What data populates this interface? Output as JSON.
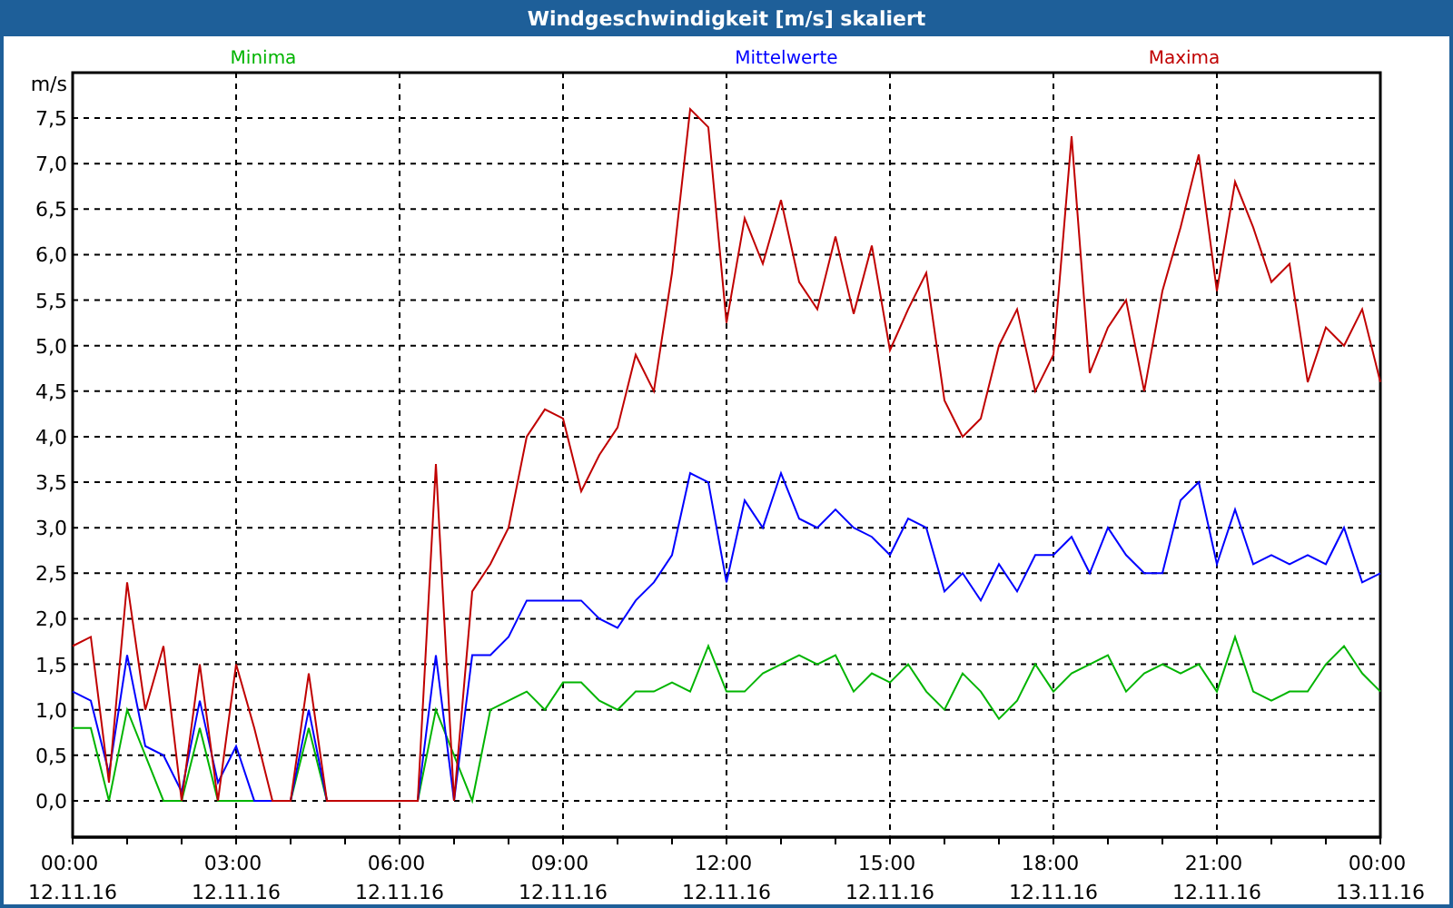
{
  "chart_data": {
    "type": "line",
    "title": "Windgeschwindigkeit [m/s] skaliert",
    "ylabel": "m/s",
    "categories": [
      "00:00 12.11.16",
      null,
      null,
      null,
      null,
      null,
      null,
      null,
      null,
      "03:00 12.11.16",
      null,
      null,
      null,
      null,
      null,
      null,
      null,
      null,
      "06:00 12.11.16",
      null,
      null,
      null,
      null,
      null,
      null,
      null,
      null,
      "09:00 12.11.16",
      null,
      null,
      null,
      null,
      null,
      null,
      null,
      null,
      "12:00 12.11.16",
      null,
      null,
      null,
      null,
      null,
      null,
      null,
      null,
      "15:00 12.11.16",
      null,
      null,
      null,
      null,
      null,
      null,
      null,
      null,
      "18:00 12.11.16",
      null,
      null,
      null,
      null,
      null,
      null,
      null,
      null,
      "21:00 12.11.16",
      null,
      null,
      null,
      null,
      null,
      null,
      null,
      null,
      "00:00 13.11.16"
    ],
    "series": [
      {
        "name": "Minima",
        "color": "#00b400",
        "values": [
          0.8,
          0.8,
          0,
          1.0,
          0.5,
          0,
          0,
          0.8,
          0,
          0,
          0,
          0,
          0,
          0.8,
          0,
          0,
          0,
          0,
          0,
          0,
          1.0,
          0.5,
          0,
          1.0,
          1.1,
          1.2,
          1.0,
          1.3,
          1.3,
          1.1,
          1.0,
          1.2,
          1.2,
          1.3,
          1.2,
          1.7,
          1.2,
          1.2,
          1.4,
          1.5,
          1.6,
          1.5,
          1.6,
          1.2,
          1.4,
          1.3,
          1.5,
          1.2,
          1.0,
          1.4,
          1.2,
          0.9,
          1.1,
          1.5,
          1.2,
          1.4,
          1.5,
          1.6,
          1.2,
          1.4,
          1.5,
          1.4,
          1.5,
          1.2,
          1.8,
          1.2,
          1.1,
          1.2,
          1.2,
          1.5,
          1.7,
          1.4,
          1.2
        ]
      },
      {
        "name": "Mittelwerte",
        "color": "#0000ff",
        "values": [
          1.2,
          1.1,
          0.3,
          1.6,
          0.6,
          0.5,
          0.1,
          1.1,
          0.2,
          0.6,
          0,
          0,
          0,
          1.0,
          0,
          0,
          0,
          0,
          0,
          0,
          1.6,
          0,
          1.6,
          1.6,
          1.8,
          2.2,
          2.2,
          2.2,
          2.2,
          2.0,
          1.9,
          2.2,
          2.4,
          2.7,
          3.6,
          3.5,
          2.4,
          3.3,
          3.0,
          3.6,
          3.1,
          3.0,
          3.2,
          3.0,
          2.9,
          2.7,
          3.1,
          3.0,
          2.3,
          2.5,
          2.2,
          2.6,
          2.3,
          2.7,
          2.7,
          2.9,
          2.5,
          3.0,
          2.7,
          2.5,
          2.5,
          3.3,
          3.5,
          2.6,
          3.2,
          2.6,
          2.7,
          2.6,
          2.7,
          2.6,
          3.0,
          2.4,
          2.5
        ]
      },
      {
        "name": "Maxima",
        "color": "#c00000",
        "values": [
          1.7,
          1.8,
          0.2,
          2.4,
          1.0,
          1.7,
          0,
          1.5,
          0,
          1.5,
          0.8,
          0,
          0,
          1.4,
          0,
          0,
          0,
          0,
          0,
          0,
          3.7,
          0,
          2.3,
          2.6,
          3.0,
          4.0,
          4.3,
          4.2,
          3.4,
          3.8,
          4.1,
          4.9,
          4.5,
          5.8,
          7.6,
          7.4,
          5.25,
          6.4,
          5.9,
          6.6,
          5.7,
          5.4,
          6.2,
          5.35,
          6.1,
          4.95,
          5.4,
          5.8,
          4.4,
          4.0,
          4.2,
          5.0,
          5.4,
          4.5,
          4.9,
          7.3,
          4.7,
          5.2,
          5.5,
          4.5,
          5.6,
          6.3,
          7.1,
          5.6,
          6.8,
          6.3,
          5.7,
          5.9,
          4.6,
          5.2,
          5.0,
          5.4,
          4.6
        ]
      }
    ],
    "ylim": [
      -0.4,
      8.0
    ],
    "grid": true,
    "yticks": [
      {
        "value": 0,
        "label": "0,0"
      },
      {
        "value": 0.5,
        "label": "0,5"
      },
      {
        "value": 1,
        "label": "1,0"
      },
      {
        "value": 1.5,
        "label": "1,5"
      },
      {
        "value": 2,
        "label": "2,0"
      },
      {
        "value": 2.5,
        "label": "2,5"
      },
      {
        "value": 3,
        "label": "3,0"
      },
      {
        "value": 3.5,
        "label": "3,5"
      },
      {
        "value": 4,
        "label": "4,0"
      },
      {
        "value": 4.5,
        "label": "4,5"
      },
      {
        "value": 5,
        "label": "5,0"
      },
      {
        "value": 5.5,
        "label": "5,5"
      },
      {
        "value": 6,
        "label": "6,0"
      },
      {
        "value": 6.5,
        "label": "6,5"
      },
      {
        "value": 7,
        "label": "7,0"
      },
      {
        "value": 7.5,
        "label": "7,5"
      }
    ]
  }
}
